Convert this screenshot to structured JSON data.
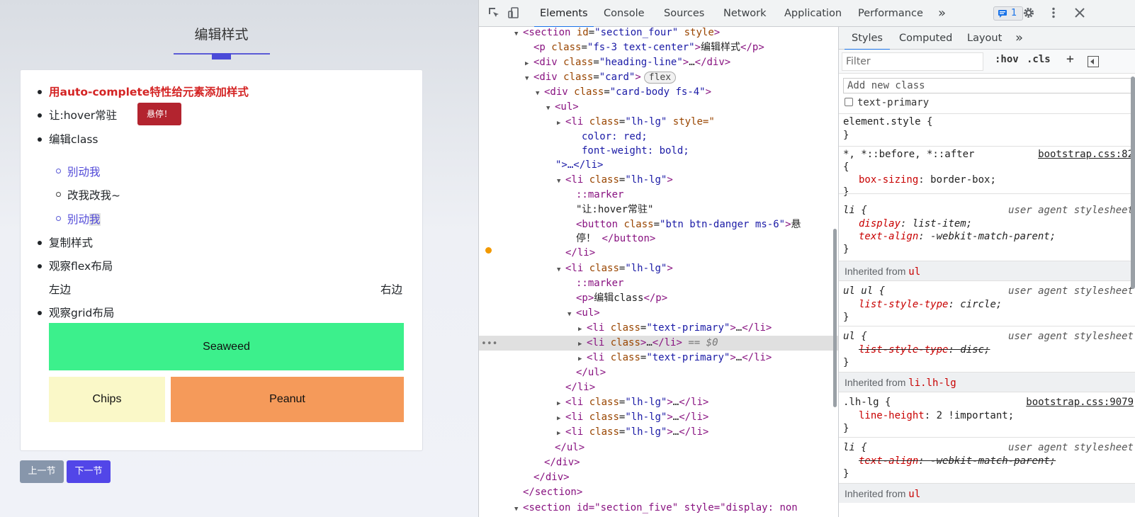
{
  "page": {
    "title": "编辑样式",
    "list": {
      "item1": "用auto-complete特性给元素添加样式",
      "item2": "让:hover常驻",
      "hover_button": "悬停！",
      "item3": "编辑class",
      "sub1": "别动我",
      "sub2": "改我改我~",
      "sub3_a": "别动",
      "sub3_b": "我",
      "item4": "复制样式",
      "item5": "观察flex布局",
      "flex_left": "左边",
      "flex_right": "右边",
      "item6": "观察grid布局"
    },
    "grid": {
      "cell1": "Seaweed",
      "cell2": "Chips",
      "cell3": "Peanut",
      "colors": {
        "seaweed": "#3cf08c",
        "chips": "#faf8c8",
        "peanut": "#f59a5a"
      }
    },
    "nav": {
      "prev": "上一节",
      "next": "下一节"
    }
  },
  "devtools": {
    "tabs": [
      "Elements",
      "Console",
      "Sources",
      "Network",
      "Application",
      "Performance"
    ],
    "more": "»",
    "badge_count": "1",
    "elements": {
      "l1_tag": "<section",
      "l1_attr1": "id",
      "l1_val1": "\"section_four\"",
      "l1_attr2": "style",
      "l1_end": ">",
      "l2_text": "编辑样式",
      "l2_cls": "\"fs-3 text-center\"",
      "l3_cls": "\"heading-line\"",
      "l4_cls": "\"card\"",
      "flex_pill": "flex",
      "l5_cls": "\"card-body fs-4\"",
      "l7_cls": "\"lh-lg\"",
      "l7_style": "style=\"",
      "l8": "color: red;",
      "l9": "font-weight: bold;",
      "l10": "\">…</li>",
      "l11_cls": "\"lh-lg\"",
      "marker": "::marker",
      "l13": "\"让:hover常驻\"",
      "l14_cls": "\"btn btn-danger ms-6\"",
      "l14_txt": "悬",
      "l15_txt": "停！",
      "l17_cls": "\"lh-lg\"",
      "l19_txt": "编辑class",
      "l21_cls": "\"text-primary\"",
      "l22_eq": "== $0",
      "l23_cls": "\"text-primary\"",
      "l26_cls": "\"lh-lg\"",
      "l27_cls": "\"lh-lg\"",
      "l28_cls": "\"lh-lg\"",
      "l_last": "section id=\"section_five\" style=\"display: non"
    },
    "styles": {
      "tabs": [
        "Styles",
        "Computed",
        "Layout"
      ],
      "filter_placeholder": "Filter",
      "hov": ":hov",
      "cls": ".cls",
      "add_class_placeholder": "Add new class",
      "class_checkbox": "text-primary",
      "r1_sel": "element.style {",
      "close": "}",
      "r2_sel": "*, *::before, *::after",
      "r2_src": "bootstrap.css:82",
      "open": "{",
      "r2_prop": "box-sizing",
      "r2_val": "border-box;",
      "r3_sel": "li {",
      "ua_label": "user agent stylesheet",
      "r3_p1": "display",
      "r3_v1": "list-item;",
      "r3_p2": "text-align",
      "r3_v2": "-webkit-match-parent;",
      "inh1": "Inherited from",
      "inh1_sel": "ul",
      "r4_sel": "ul ul {",
      "r4_prop": "list-style-type",
      "r4_val": "circle;",
      "r5_sel": "ul {",
      "r5_prop": "list-style-type",
      "r5_val": "disc;",
      "inh2_sel": "li.lh-lg",
      "r6_sel": ".lh-lg {",
      "r6_src": "bootstrap.css:9079",
      "r6_prop": "line-height",
      "r6_val": "2 !important;",
      "r7_sel": "li {",
      "r7_prop": "text-align",
      "r7_val": "-webkit-match-parent;",
      "inh3_sel": "ul"
    }
  }
}
